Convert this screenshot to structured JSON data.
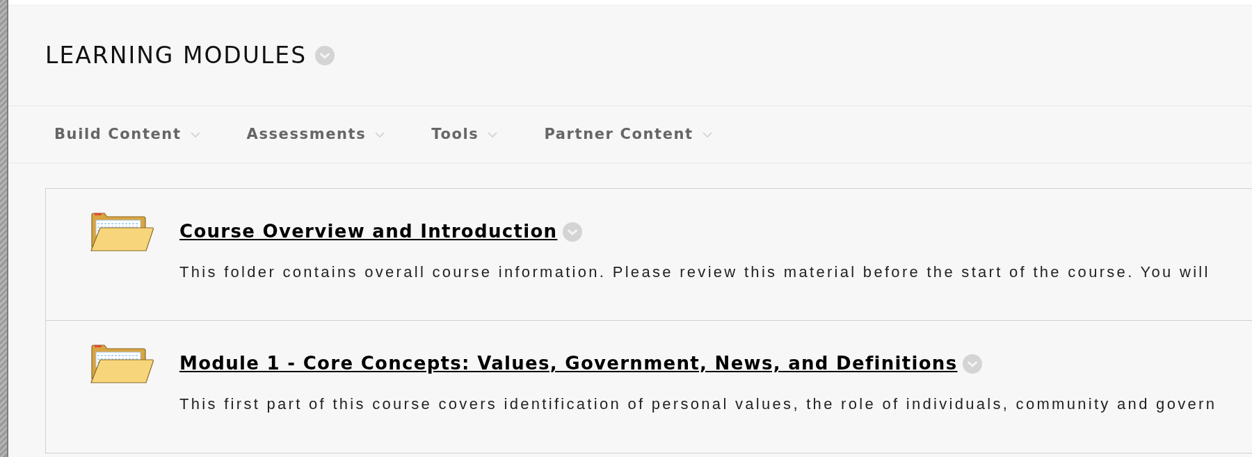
{
  "page_title": "LEARNING MODULES",
  "menu": [
    {
      "label": "Build Content"
    },
    {
      "label": "Assessments"
    },
    {
      "label": "Tools"
    },
    {
      "label": "Partner Content"
    }
  ],
  "items": [
    {
      "kind": "folder",
      "title": "Course Overview and Introduction",
      "description": "This folder contains overall course information. Please review this material before the start of the course. You will"
    },
    {
      "kind": "folder",
      "title": "Module 1 - Core Concepts: Values, Government, News, and Definitions",
      "description": "This first part of this course covers identification of personal values, the role of individuals, community and govern"
    }
  ]
}
